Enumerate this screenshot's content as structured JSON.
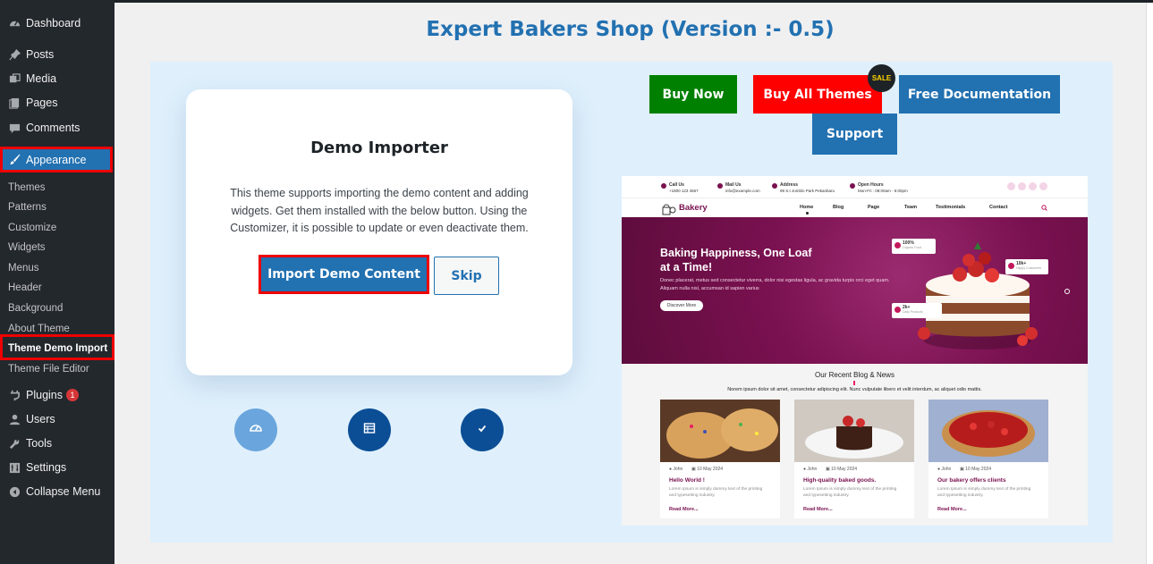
{
  "sidebar": {
    "items": [
      {
        "label": "Dashboard",
        "icon": "dashboard-icon"
      },
      {
        "label": "Posts",
        "icon": "pin-icon"
      },
      {
        "label": "Media",
        "icon": "media-icon"
      },
      {
        "label": "Pages",
        "icon": "pages-icon"
      },
      {
        "label": "Comments",
        "icon": "comments-icon"
      },
      {
        "label": "Appearance",
        "icon": "paintbrush-icon",
        "active": true
      },
      {
        "label": "Plugins",
        "icon": "plugin-icon",
        "badge": "1"
      },
      {
        "label": "Users",
        "icon": "user-icon"
      },
      {
        "label": "Tools",
        "icon": "wrench-icon"
      },
      {
        "label": "Settings",
        "icon": "settings-icon"
      },
      {
        "label": "Collapse Menu",
        "icon": "collapse-icon"
      }
    ],
    "submenu": [
      "Themes",
      "Patterns",
      "Customize",
      "Widgets",
      "Menus",
      "Header",
      "Background",
      "About Theme",
      "Theme Demo Import",
      "Theme File Editor"
    ],
    "active_submenu": "Theme Demo Import"
  },
  "page": {
    "title": "Expert Bakers Shop (Version :- 0.5)"
  },
  "importer": {
    "title": "Demo Importer",
    "description": "This theme supports importing the demo content and adding widgets. Get them installed with the below button. Using the Customizer, it is possible to update or even deactivate them.",
    "import_button": "Import Demo Content",
    "skip_button": "Skip",
    "steps": [
      "dashboard-icon",
      "table-icon",
      "check-icon"
    ]
  },
  "actions": {
    "buy_now": "Buy Now",
    "buy_all": "Buy All Themes",
    "sale": "SALE",
    "docs": "Free Documentation",
    "support": "Support"
  },
  "preview": {
    "info": [
      {
        "title": "Call Us",
        "text": "+1800 123 4567"
      },
      {
        "title": "Mail Us",
        "text": "info@example.com"
      },
      {
        "title": "Address",
        "text": "99 S.t Jomblo Park Pekanbaru"
      },
      {
        "title": "Open Hours",
        "text": "Mon-Fri : 08:00am - 6:00pm"
      }
    ],
    "logo": "Bakery",
    "nav": [
      "Home",
      "Blog",
      "Page",
      "Team",
      "Testimonials",
      "Contact"
    ],
    "hero_title": "Baking Happiness, One Loaf at a Time!",
    "hero_text": "Donec placerat, metus sed consectetur viverra, dolor nisi egestas ligula, ac gravida turpis orci eget quam. Aliquam nulla nisl, accumsan id sapien varius",
    "hero_button": "Discover More",
    "stats": [
      {
        "value": "100%",
        "label": "Organic Food"
      },
      {
        "value": "10k+",
        "label": "Happy Customers"
      },
      {
        "value": "2k+",
        "label": "Daily Products"
      }
    ],
    "blog_title": "Our Recent Blog & News",
    "blog_subtitle": "Norem ipsum dolor sit amet, consectetur adipiscing elit. Nunc vulputate libero et velit interdum, ac aliquet odio mattis.",
    "posts": [
      {
        "author": "John",
        "date": "10 May 2024",
        "title": "Hello World !",
        "text": "Lorem Ipsum is simply dummy text of the printing and typesetting industry.",
        "more": "Read More..."
      },
      {
        "author": "John",
        "date": "10 May 2024",
        "title": "High-quality baked goods.",
        "text": "Lorem Ipsum is simply dummy text of the printing and typesetting industry.",
        "more": "Read More..."
      },
      {
        "author": "John",
        "date": "10 May 2024",
        "title": "Our bakery offers clients",
        "text": "Lorem Ipsum is simply dummy text of the printing and typesetting industry.",
        "more": "Read More..."
      }
    ]
  }
}
